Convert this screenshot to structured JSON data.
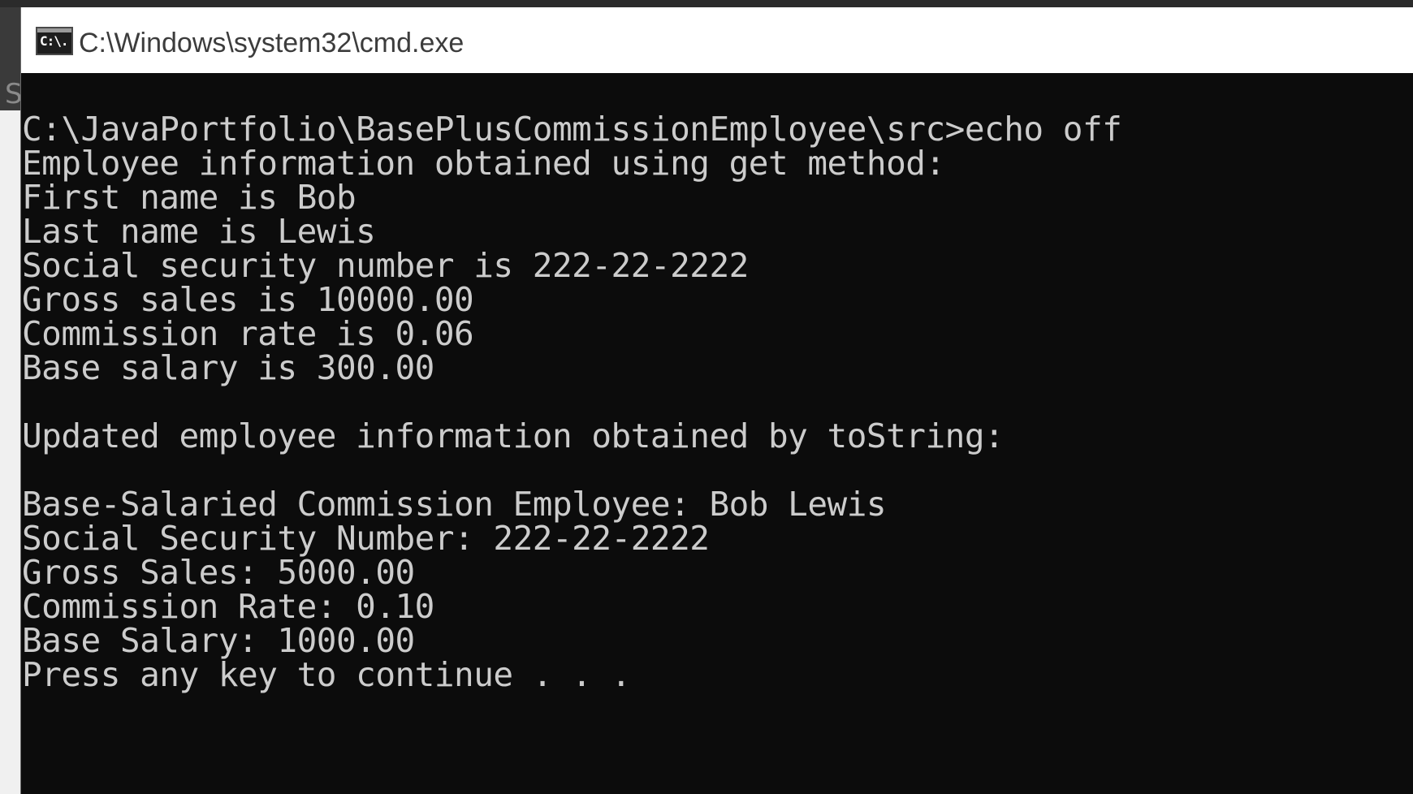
{
  "window": {
    "title": "C:\\Windows\\system32\\cmd.exe",
    "icon": "cmd-icon",
    "background_color": "#0c0c0c",
    "text_color": "#cccccc"
  },
  "background": {
    "partial_letter": "S"
  },
  "console": {
    "prompt_line": "C:\\JavaPortfolio\\BasePlusCommissionEmployee\\src>echo off",
    "get_header": "Employee information obtained using get method:",
    "first_name": "First name is Bob",
    "last_name": "Last name is Lewis",
    "ssn": "Social security number is 222-22-2222",
    "gross_sales": "Gross sales is 10000.00",
    "commission_rate": "Commission rate is 0.06",
    "base_salary": "Base salary is 300.00",
    "tostring_header": "Updated employee information obtained by toString:",
    "employee": "Base-Salaried Commission Employee: Bob Lewis",
    "ssn_updated": "Social Security Number: 222-22-2222",
    "gross_sales_updated": "Gross Sales: 5000.00",
    "commission_rate_updated": "Commission Rate: 0.10",
    "base_salary_updated": "Base Salary: 1000.00",
    "pause": "Press any key to continue . . ."
  }
}
